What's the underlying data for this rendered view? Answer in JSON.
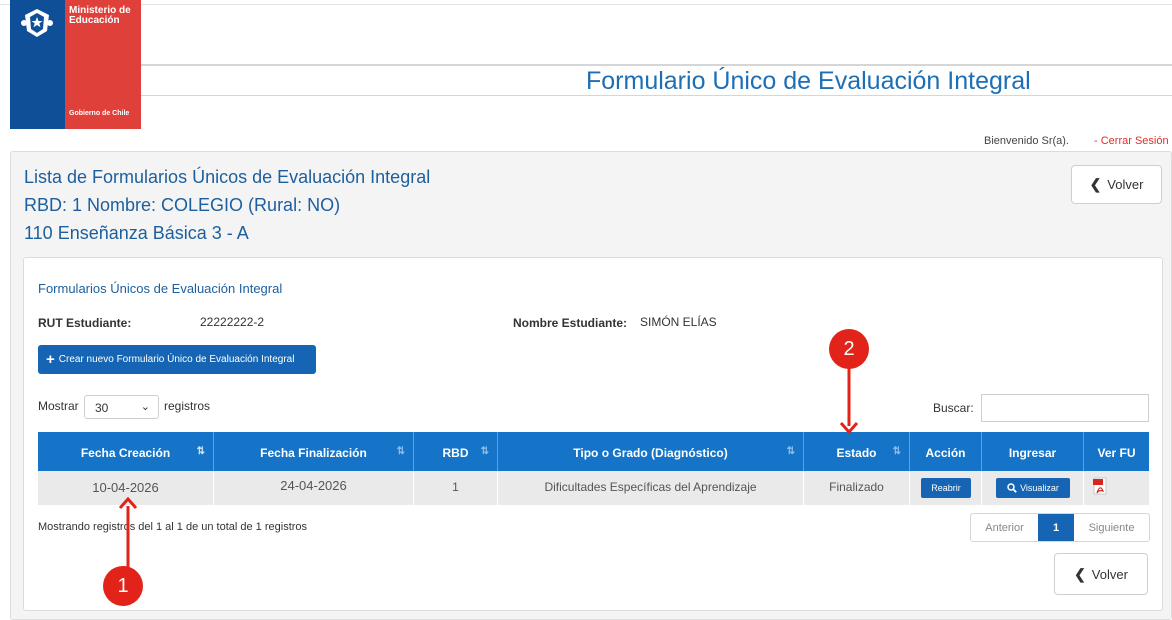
{
  "header": {
    "ministry_line1": "Ministerio de",
    "ministry_line2": "Educación",
    "government": "Gobierno de Chile",
    "app_title": "Formulario Único de Evaluación Integral",
    "welcome": "Bienvenido Sr(a).",
    "logout": "- Cerrar Sesión"
  },
  "page": {
    "title_line1": "Lista de Formularios Únicos de Evaluación Integral",
    "title_line2": "RBD: 1 Nombre: COLEGIO   (Rural: NO)",
    "title_line3": "110 Enseñanza Básica 3 - A",
    "back_label": "Volver"
  },
  "section": {
    "title": "Formularios Únicos de Evaluación Integral",
    "rut_label": "RUT Estudiante:",
    "rut_value": "22222222-2",
    "name_label": "Nombre Estudiante:",
    "name_value": "SIMÓN ELÍAS",
    "create_label": "Crear nuevo Formulario Único de Evaluación Integral"
  },
  "table_controls": {
    "show_label": "Mostrar",
    "page_size": "30",
    "records_label": "registros",
    "search_label": "Buscar:"
  },
  "table": {
    "headers": [
      "Fecha Creación",
      "Fecha Finalización",
      "RBD",
      "Tipo o Grado (Diagnóstico)",
      "Estado",
      "Acción",
      "Ingresar",
      "Ver FU"
    ],
    "rows": [
      {
        "fecha_creacion": "10-04-2026",
        "fecha_finalizacion": "24-04-2026",
        "rbd": "1",
        "tipo": "Dificultades Específicas del Aprendizaje",
        "estado": "Finalizado",
        "accion_label": "Reabrir",
        "ingresar_label": "Visualizar"
      }
    ]
  },
  "footer": {
    "info": "Mostrando registros del 1 al 1 de un total de 1 registros",
    "prev": "Anterior",
    "current_page": "1",
    "next": "Siguiente",
    "back_label": "Volver"
  },
  "annotations": [
    "1",
    "2"
  ],
  "colors": {
    "primary": "#1565b4",
    "header_blue": "#1574c7",
    "logo_blue": "#0f4f97",
    "logo_red": "#e0403a",
    "annotation_red": "#e2231a"
  }
}
